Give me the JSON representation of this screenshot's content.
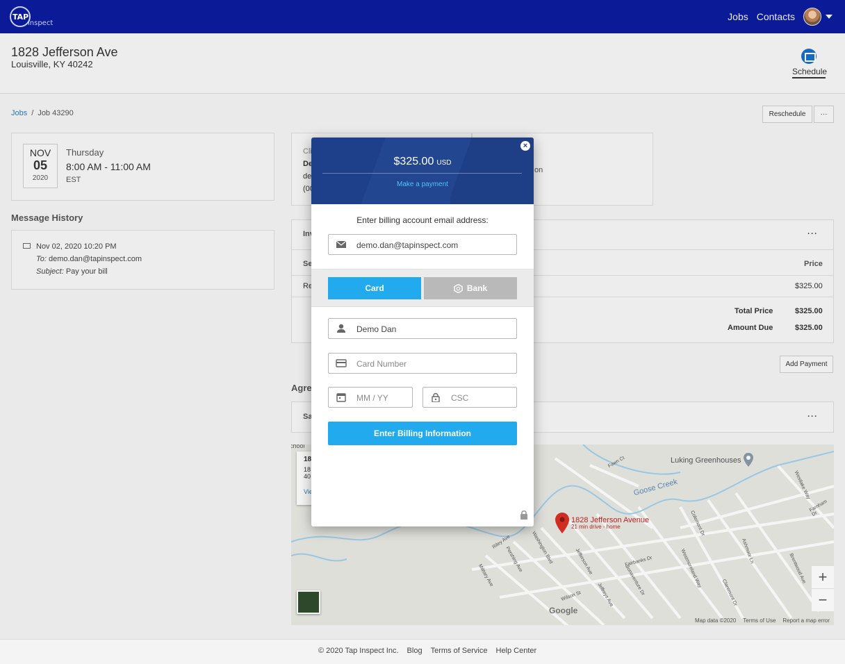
{
  "nav": {
    "jobs": "Jobs",
    "contacts": "Contacts"
  },
  "header": {
    "address_line1": "1828 Jefferson Ave",
    "address_line2": "Louisville, KY 40242",
    "schedule": "Schedule"
  },
  "breadcrumb": {
    "jobs": "Jobs",
    "sep": "/",
    "current": "Job 43290"
  },
  "toolbar": {
    "reschedule": "Reschedule",
    "more": "···"
  },
  "appointment": {
    "month": "NOV",
    "day": "05",
    "year": "2020",
    "weekday": "Thursday",
    "time": "8:00 AM - 11:00 AM",
    "tz": "EST"
  },
  "message_history": {
    "title": "Message History",
    "date": "Nov 02, 2020 10:20 PM",
    "to_label": "To:",
    "to": "demo.dan@tapinspect.com",
    "subject_label": "Subject:",
    "subject": "Pay your bill"
  },
  "partial": {
    "cli": "Cli",
    "de": "De",
    "de2": "de",
    "phone": "(00",
    "on": "on",
    "inv": "Inv",
    "se": "Se",
    "re": "Re",
    "agre": "Agre",
    "sa": "Sa",
    "map_info_1": "18",
    "map_info_2": "18",
    "map_info_3": "40",
    "map_info_4": "Vie"
  },
  "invoice": {
    "price_header": "Price",
    "line_price": "$325.00",
    "total_label": "Total Price",
    "total": "$325.00",
    "due_label": "Amount Due",
    "due": "$325.00",
    "add_payment": "Add Payment"
  },
  "map": {
    "poi": "Luking Greenhouses",
    "pin": "1828 Jefferson Avenue",
    "pin_sub": "21 min drive - home",
    "creek": "Goose Creek",
    "google": "Google",
    "footer": [
      "Map data ©2020",
      "Terms of Use",
      "Report a map error"
    ],
    "zoom_in": "+",
    "zoom_out": "−",
    "streets": [
      "Fawn Ct",
      "Westlake Way",
      "Farnham Dr",
      "Riley Ave",
      "Pershing Ave",
      "Washington Blvd",
      "Jefferson Ave",
      "Jeffreys Ave",
      "Bonaventure Dr",
      "Westmoreland Way",
      "Colemont Dr",
      "Ashmoor Ln",
      "Claremont Dr",
      "Military Ave",
      "Wilson St",
      "Fairbanks Dr",
      "Brentwood Ave"
    ],
    "school": "chool"
  },
  "modal": {
    "amount": "$325.00",
    "currency": "USD",
    "make_payment": "Make a payment",
    "close": "×",
    "email_label": "Enter billing account email address:",
    "email": "demo.dan@tapinspect.com",
    "tab_card": "Card",
    "tab_bank": "Bank",
    "name": "Demo Dan",
    "card_number_placeholder": "Card Number",
    "expiry_placeholder": "MM / YY",
    "csc_placeholder": "CSC",
    "submit": "Enter Billing Information"
  },
  "footer": {
    "copyright": "© 2020 Tap Inspect Inc.",
    "blog": "Blog",
    "terms": "Terms of Service",
    "help": "Help Center"
  },
  "colors": {
    "topbar": "#0b1a96",
    "accent": "#21aaee",
    "modal_header": "#224690",
    "bank_tab": "#b9b9b9"
  }
}
